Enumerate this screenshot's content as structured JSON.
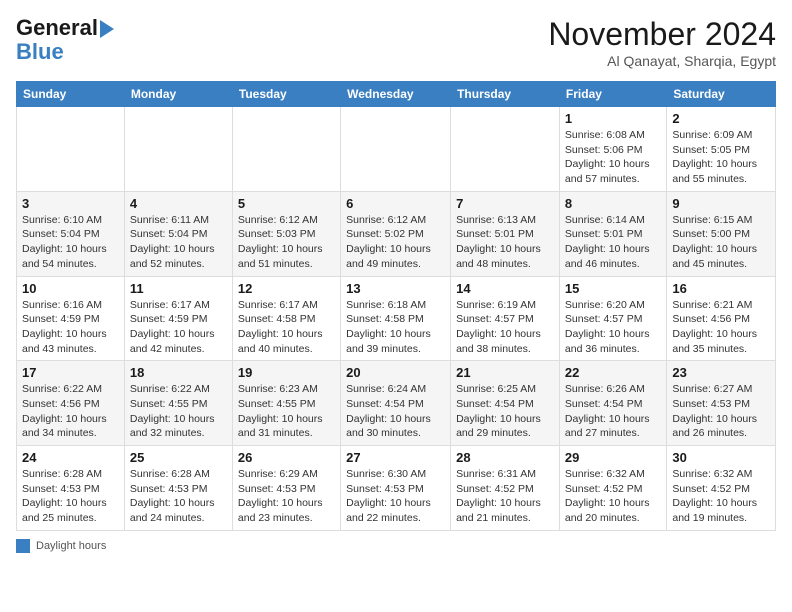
{
  "logo": {
    "line1": "General",
    "line2": "Blue"
  },
  "header": {
    "month": "November 2024",
    "location": "Al Qanayat, Sharqia, Egypt"
  },
  "days_of_week": [
    "Sunday",
    "Monday",
    "Tuesday",
    "Wednesday",
    "Thursday",
    "Friday",
    "Saturday"
  ],
  "weeks": [
    [
      {
        "day": "",
        "info": ""
      },
      {
        "day": "",
        "info": ""
      },
      {
        "day": "",
        "info": ""
      },
      {
        "day": "",
        "info": ""
      },
      {
        "day": "",
        "info": ""
      },
      {
        "day": "1",
        "info": "Sunrise: 6:08 AM\nSunset: 5:06 PM\nDaylight: 10 hours and 57 minutes."
      },
      {
        "day": "2",
        "info": "Sunrise: 6:09 AM\nSunset: 5:05 PM\nDaylight: 10 hours and 55 minutes."
      }
    ],
    [
      {
        "day": "3",
        "info": "Sunrise: 6:10 AM\nSunset: 5:04 PM\nDaylight: 10 hours and 54 minutes."
      },
      {
        "day": "4",
        "info": "Sunrise: 6:11 AM\nSunset: 5:04 PM\nDaylight: 10 hours and 52 minutes."
      },
      {
        "day": "5",
        "info": "Sunrise: 6:12 AM\nSunset: 5:03 PM\nDaylight: 10 hours and 51 minutes."
      },
      {
        "day": "6",
        "info": "Sunrise: 6:12 AM\nSunset: 5:02 PM\nDaylight: 10 hours and 49 minutes."
      },
      {
        "day": "7",
        "info": "Sunrise: 6:13 AM\nSunset: 5:01 PM\nDaylight: 10 hours and 48 minutes."
      },
      {
        "day": "8",
        "info": "Sunrise: 6:14 AM\nSunset: 5:01 PM\nDaylight: 10 hours and 46 minutes."
      },
      {
        "day": "9",
        "info": "Sunrise: 6:15 AM\nSunset: 5:00 PM\nDaylight: 10 hours and 45 minutes."
      }
    ],
    [
      {
        "day": "10",
        "info": "Sunrise: 6:16 AM\nSunset: 4:59 PM\nDaylight: 10 hours and 43 minutes."
      },
      {
        "day": "11",
        "info": "Sunrise: 6:17 AM\nSunset: 4:59 PM\nDaylight: 10 hours and 42 minutes."
      },
      {
        "day": "12",
        "info": "Sunrise: 6:17 AM\nSunset: 4:58 PM\nDaylight: 10 hours and 40 minutes."
      },
      {
        "day": "13",
        "info": "Sunrise: 6:18 AM\nSunset: 4:58 PM\nDaylight: 10 hours and 39 minutes."
      },
      {
        "day": "14",
        "info": "Sunrise: 6:19 AM\nSunset: 4:57 PM\nDaylight: 10 hours and 38 minutes."
      },
      {
        "day": "15",
        "info": "Sunrise: 6:20 AM\nSunset: 4:57 PM\nDaylight: 10 hours and 36 minutes."
      },
      {
        "day": "16",
        "info": "Sunrise: 6:21 AM\nSunset: 4:56 PM\nDaylight: 10 hours and 35 minutes."
      }
    ],
    [
      {
        "day": "17",
        "info": "Sunrise: 6:22 AM\nSunset: 4:56 PM\nDaylight: 10 hours and 34 minutes."
      },
      {
        "day": "18",
        "info": "Sunrise: 6:22 AM\nSunset: 4:55 PM\nDaylight: 10 hours and 32 minutes."
      },
      {
        "day": "19",
        "info": "Sunrise: 6:23 AM\nSunset: 4:55 PM\nDaylight: 10 hours and 31 minutes."
      },
      {
        "day": "20",
        "info": "Sunrise: 6:24 AM\nSunset: 4:54 PM\nDaylight: 10 hours and 30 minutes."
      },
      {
        "day": "21",
        "info": "Sunrise: 6:25 AM\nSunset: 4:54 PM\nDaylight: 10 hours and 29 minutes."
      },
      {
        "day": "22",
        "info": "Sunrise: 6:26 AM\nSunset: 4:54 PM\nDaylight: 10 hours and 27 minutes."
      },
      {
        "day": "23",
        "info": "Sunrise: 6:27 AM\nSunset: 4:53 PM\nDaylight: 10 hours and 26 minutes."
      }
    ],
    [
      {
        "day": "24",
        "info": "Sunrise: 6:28 AM\nSunset: 4:53 PM\nDaylight: 10 hours and 25 minutes."
      },
      {
        "day": "25",
        "info": "Sunrise: 6:28 AM\nSunset: 4:53 PM\nDaylight: 10 hours and 24 minutes."
      },
      {
        "day": "26",
        "info": "Sunrise: 6:29 AM\nSunset: 4:53 PM\nDaylight: 10 hours and 23 minutes."
      },
      {
        "day": "27",
        "info": "Sunrise: 6:30 AM\nSunset: 4:53 PM\nDaylight: 10 hours and 22 minutes."
      },
      {
        "day": "28",
        "info": "Sunrise: 6:31 AM\nSunset: 4:52 PM\nDaylight: 10 hours and 21 minutes."
      },
      {
        "day": "29",
        "info": "Sunrise: 6:32 AM\nSunset: 4:52 PM\nDaylight: 10 hours and 20 minutes."
      },
      {
        "day": "30",
        "info": "Sunrise: 6:32 AM\nSunset: 4:52 PM\nDaylight: 10 hours and 19 minutes."
      }
    ]
  ],
  "footer": {
    "label": "Daylight hours"
  }
}
